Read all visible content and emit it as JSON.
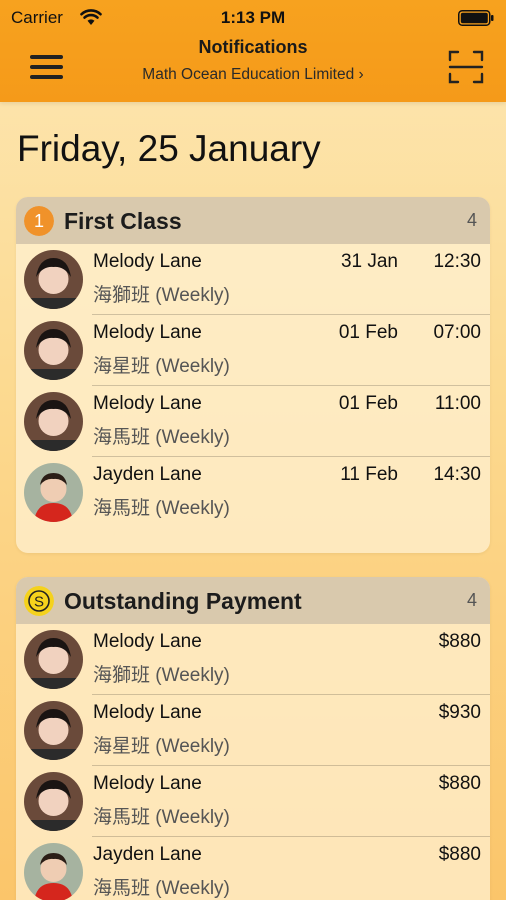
{
  "status_bar": {
    "carrier": "Carrier",
    "time": "1:13 PM"
  },
  "nav": {
    "title": "Notifications",
    "subtitle": "Math Ocean Education Limited ›"
  },
  "date_heading": "Friday, 25 January",
  "sections": {
    "first_class": {
      "badge": "1",
      "title": "First Class",
      "count": "4",
      "items": [
        {
          "name": "Melody Lane",
          "class": "海獅班 (Weekly)",
          "date": "31 Jan",
          "time": "12:30"
        },
        {
          "name": "Melody Lane",
          "class": "海星班 (Weekly)",
          "date": "01 Feb",
          "time": "07:00"
        },
        {
          "name": "Melody Lane",
          "class": "海馬班 (Weekly)",
          "date": "01 Feb",
          "time": "11:00"
        },
        {
          "name": "Jayden Lane",
          "class": "海馬班 (Weekly)",
          "date": "11 Feb",
          "time": "14:30"
        }
      ]
    },
    "outstanding_payment": {
      "badge": "S",
      "title": "Outstanding Payment",
      "count": "4",
      "items": [
        {
          "name": "Melody Lane",
          "class": "海獅班 (Weekly)",
          "amount": "$880"
        },
        {
          "name": "Melody Lane",
          "class": "海星班 (Weekly)",
          "amount": "$930"
        },
        {
          "name": "Melody Lane",
          "class": "海馬班 (Weekly)",
          "amount": "$880"
        },
        {
          "name": "Jayden Lane",
          "class": "海馬班 (Weekly)",
          "amount": "$880"
        }
      ]
    }
  },
  "colors": {
    "header": "#f59a19",
    "badge_orange": "#f0922a",
    "badge_yellow": "#f5d21c",
    "section_header": "#d9c9ad"
  },
  "icons": {
    "menu": "hamburger-menu-icon",
    "scan": "qr-scan-icon",
    "first_class_badge": "number-one-icon",
    "payment_badge": "dollar-coin-icon"
  }
}
